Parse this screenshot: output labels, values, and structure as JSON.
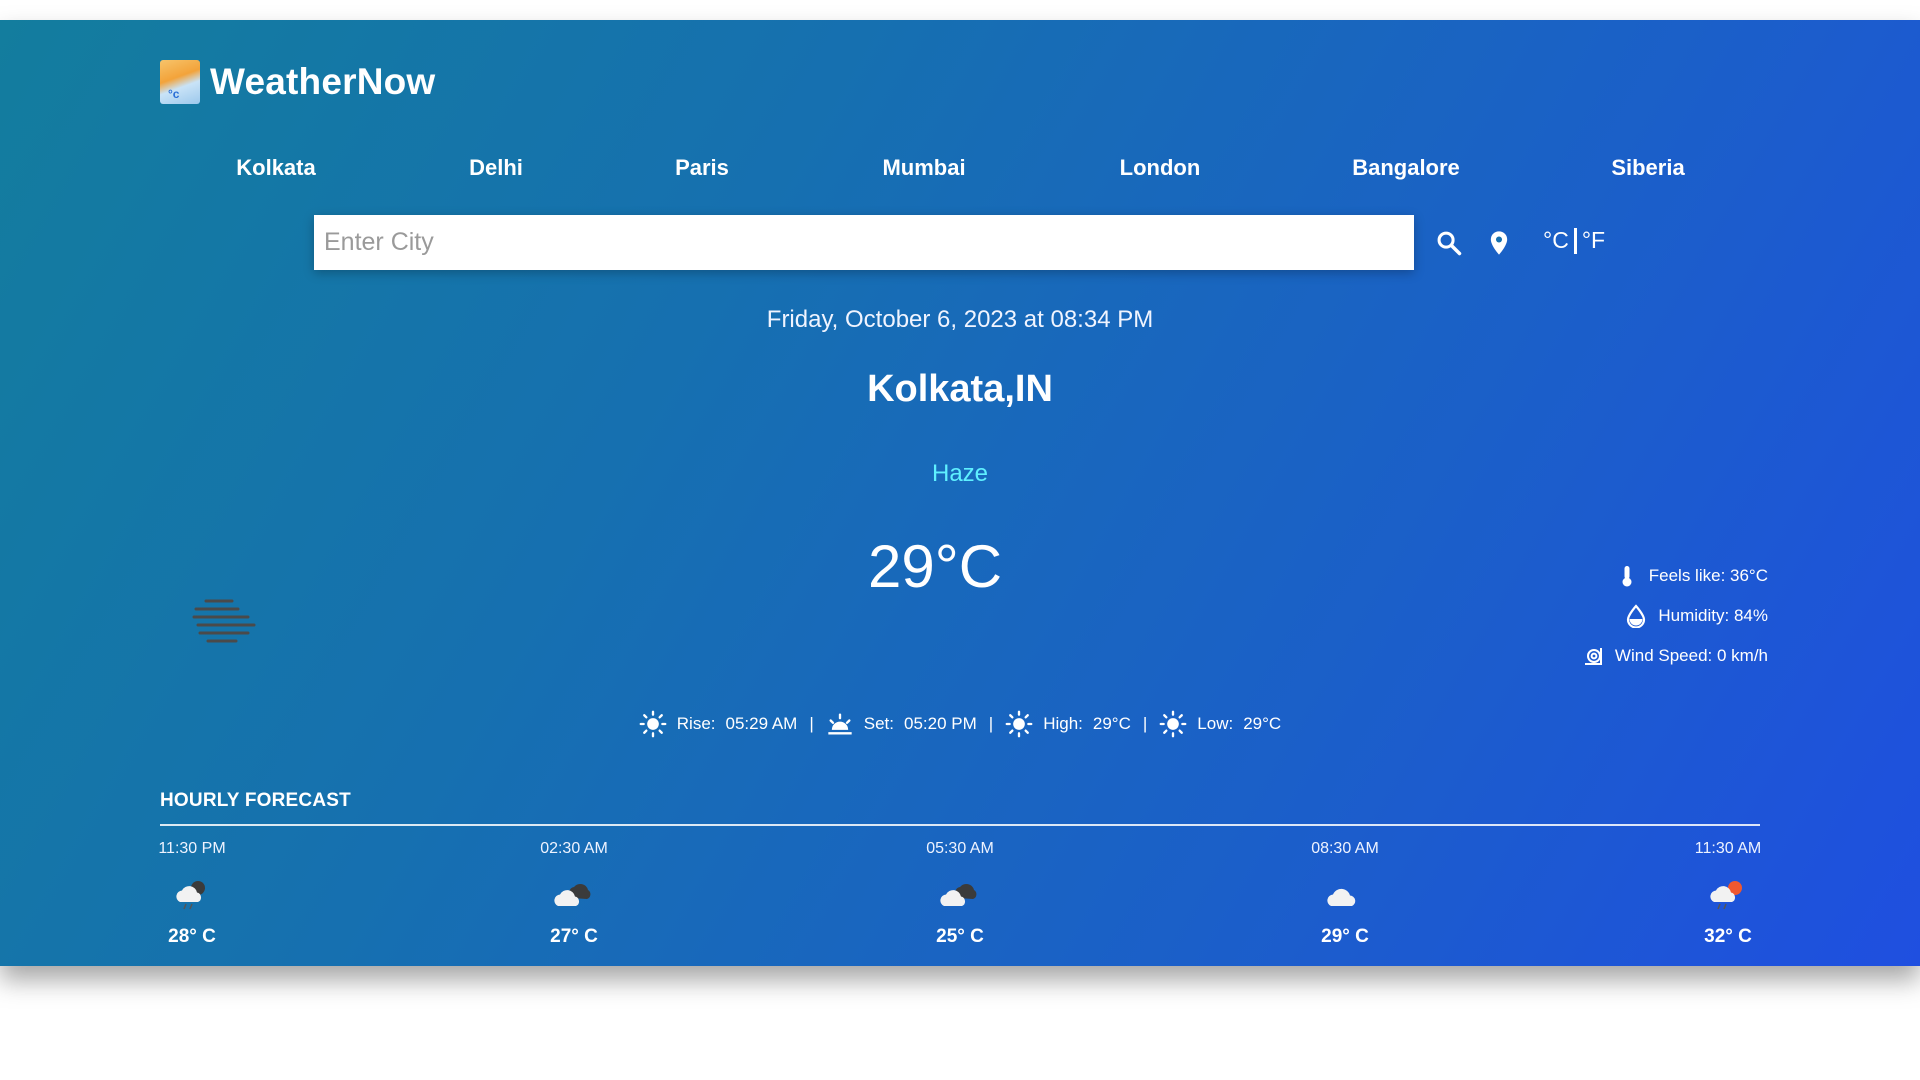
{
  "brand": {
    "name": "WeatherNow",
    "logo_icon": "weather-app-logo"
  },
  "cities": [
    "Kolkata",
    "Delhi",
    "Paris",
    "Mumbai",
    "London",
    "Bangalore",
    "Siberia"
  ],
  "search": {
    "placeholder": "Enter City",
    "value": ""
  },
  "units": {
    "celsius": "°C",
    "fahrenheit": "°F"
  },
  "current": {
    "datetime": "Friday, October 6, 2023 at 08:34 PM",
    "location": "Kolkata,IN",
    "condition": "Haze",
    "temperature": "29°C",
    "condition_icon": "haze-icon",
    "condition_color": "#5ff0ff"
  },
  "details": {
    "feels_like": "Feels like: 36°C",
    "humidity": "Humidity: 84%",
    "wind_speed": "Wind Speed: 0 km/h"
  },
  "sun": {
    "rise_label": "Rise:",
    "rise": "05:29 AM",
    "set_label": "Set:",
    "set": "05:20 PM",
    "high_label": "High:",
    "high": "29°C",
    "low_label": "Low:",
    "low": "29°C"
  },
  "forecast": {
    "title": "HOURLY FORECAST",
    "hours": [
      {
        "time": "11:30 PM",
        "temp": "28° C",
        "icon": "cloud-night-icon"
      },
      {
        "time": "02:30 AM",
        "temp": "27° C",
        "icon": "broken-clouds-icon"
      },
      {
        "time": "05:30 AM",
        "temp": "25° C",
        "icon": "broken-clouds-icon"
      },
      {
        "time": "08:30 AM",
        "temp": "29° C",
        "icon": "cloud-icon"
      },
      {
        "time": "11:30 AM",
        "temp": "32° C",
        "icon": "cloud-sun-icon"
      }
    ]
  },
  "colors": {
    "gradient_start": "#137d9e",
    "gradient_end": "#1f4fe0"
  }
}
